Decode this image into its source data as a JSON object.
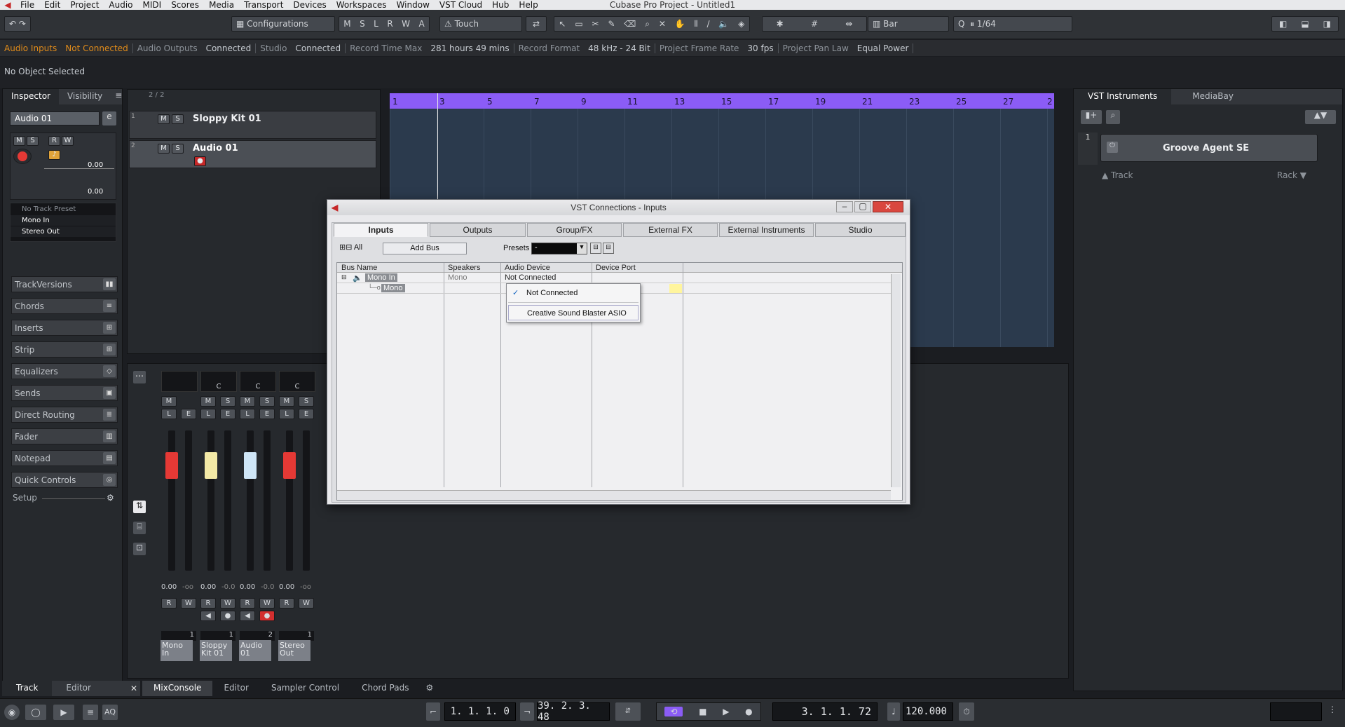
{
  "app": {
    "menu": [
      "File",
      "Edit",
      "Project",
      "Audio",
      "MIDI",
      "Scores",
      "Media",
      "Transport",
      "Devices",
      "Workspaces",
      "Window",
      "VST Cloud",
      "Hub",
      "Help"
    ],
    "title": "Cubase Pro Project - Untitled1"
  },
  "toolbar": {
    "configurations": "Configurations",
    "mode_buttons": [
      "M",
      "S",
      "L",
      "R",
      "W",
      "A"
    ],
    "automation_mode": "Touch",
    "snap_type": "Bar",
    "quantize": "1/64"
  },
  "status": {
    "audio_inputs_label": "Audio Inputs",
    "audio_inputs_value": "Not Connected",
    "audio_outputs_label": "Audio Outputs",
    "audio_outputs_value": "Connected",
    "studio_label": "Studio",
    "studio_value": "Connected",
    "record_time_label": "Record Time Max",
    "record_time_value": "281 hours 49 mins",
    "record_format_label": "Record Format",
    "record_format_value": "48 kHz - 24 Bit",
    "frame_rate_label": "Project Frame Rate",
    "frame_rate_value": "30 fps",
    "pan_law_label": "Project Pan Law",
    "pan_law_value": "Equal Power"
  },
  "selection": "No Object Selected",
  "inspector": {
    "tabs": [
      "Inspector",
      "Visibility"
    ],
    "track_name": "Audio 01",
    "value1": "0.00",
    "value2": "0.00",
    "preset": "No Track Preset",
    "input": "Mono In",
    "output": "Stereo Out",
    "sections": [
      "TrackVersions",
      "Chords",
      "Inserts",
      "Strip",
      "Equalizers",
      "Sends",
      "Direct Routing",
      "Fader",
      "Notepad",
      "Quick Controls"
    ],
    "setup": "Setup"
  },
  "tracklist": {
    "count": "2 / 2",
    "tracks": [
      {
        "num": "1",
        "name": "Sloppy Kit 01"
      },
      {
        "num": "2",
        "name": "Audio 01"
      }
    ]
  },
  "ruler": [
    "1",
    "3",
    "5",
    "7",
    "9",
    "11",
    "13",
    "15",
    "17",
    "19",
    "21",
    "23",
    "25",
    "27",
    "2"
  ],
  "mixer": {
    "pan_values": [
      "C",
      "C",
      "C"
    ],
    "levels": [
      "0.00",
      "-oo",
      "0.00",
      "-0.0",
      "0.00",
      "-0.0",
      "0.00",
      "-oo"
    ],
    "channel_numbers": [
      "1",
      "1",
      "2",
      "1"
    ],
    "channels": [
      "Mono In",
      "Sloppy Kit 01",
      "Audio 01",
      "Stereo Out"
    ]
  },
  "lower_tabs": {
    "left": [
      "Track",
      "Editor"
    ],
    "right": [
      "MixConsole",
      "Editor",
      "Sampler Control",
      "Chord Pads"
    ]
  },
  "right": {
    "tabs": [
      "VST Instruments",
      "MediaBay"
    ],
    "slot": "1",
    "instrument": "Groove Agent SE",
    "track_label": "Track",
    "rack_label": "Rack"
  },
  "dialog": {
    "title": "VST Connections - Inputs",
    "tabs": [
      "Inputs",
      "Outputs",
      "Group/FX",
      "External FX",
      "External Instruments",
      "Studio"
    ],
    "all_label": "All",
    "add_bus": "Add Bus",
    "presets_label": "Presets",
    "presets_value": "-",
    "columns": [
      "Bus Name",
      "Speakers",
      "Audio Device",
      "Device Port"
    ],
    "bus_name": "Mono In",
    "bus_speakers": "Mono",
    "bus_device": "Not Connected",
    "sub_name": "Mono",
    "menu_items": [
      "Not Connected",
      "Creative Sound Blaster ASIO"
    ]
  },
  "transport": {
    "left_locator": "1. 1. 1.  0",
    "right_locator": "39. 2. 3. 48",
    "position": "3. 1. 1. 72",
    "tempo": "120.000",
    "aq": "AQ"
  },
  "colors": {
    "ruler": "#8b5cf6",
    "accent": "#e08b1a",
    "record": "#e53935"
  }
}
